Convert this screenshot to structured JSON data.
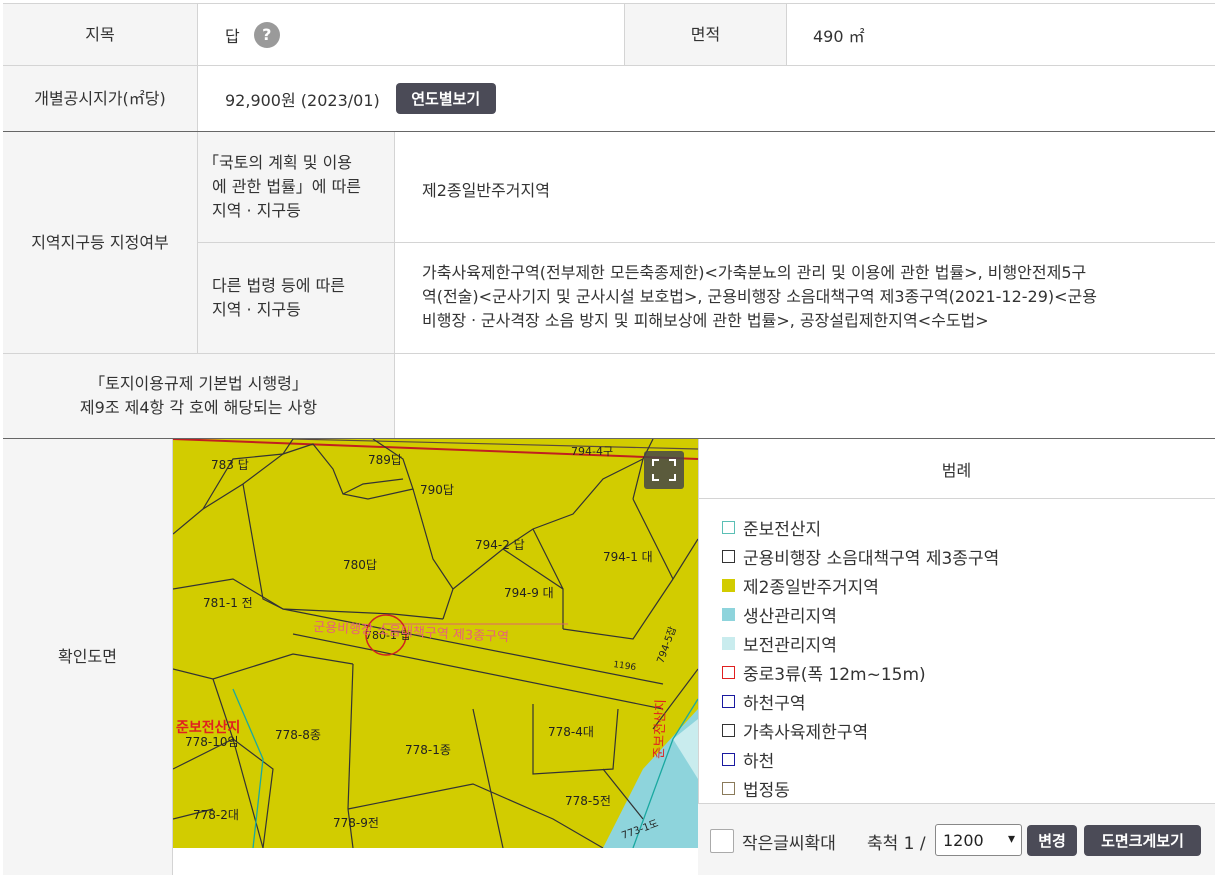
{
  "row1": {
    "jimok_label": "지목",
    "jimok_value": "답",
    "help_icon": "?",
    "area_label": "면적",
    "area_value": "490 ㎡"
  },
  "row2": {
    "price_label": "개별공시지가(㎡당)",
    "price_value": "92,900원 (2023/01)",
    "yearly_button": "연도별보기"
  },
  "zone": {
    "label": "지역지구등 지정여부",
    "sub1_label": [
      "「국토의 계획 및 이용",
      "에 관한 법률」에 따른",
      "지역 · 지구등"
    ],
    "sub1_value": "제2종일반주거지역",
    "sub2_label": [
      "다른 법령 등에 따른",
      "지역 · 지구등"
    ],
    "sub2_value": [
      "가축사육제한구역(전부제한 모든축종제한)<가축분뇨의 관리 및 이용에 관한 법률>, 비행안전제5구",
      "역(전술)<군사기지 및 군사시설 보호법>, 군용비행장 소음대책구역 제3종구역(2021-12-29)<군용",
      "비행장ㆍ군사격장 소음 방지 및 피해보상에 관한 법률>, 공장설립제한지역<수도법>"
    ]
  },
  "enforcement": {
    "label": [
      "「토지이용규제 기본법 시행령」",
      "제9조 제4항 각 호에 해당되는 사항"
    ],
    "value": ""
  },
  "map_section": {
    "label": "확인도면",
    "fullscreen_icon": "fullscreen-icon",
    "parcels": [
      "783 답",
      "789답",
      "790답",
      "780답",
      "794-2 답",
      "794-1 대",
      "794-9 대",
      "781-1 전",
      "780-1 답",
      "778-10임",
      "778-8종",
      "778-1종",
      "778-4대",
      "778-2대",
      "778-9전",
      "778-5전",
      "794-4구",
      "794-5잡",
      "773-1도",
      "1196"
    ],
    "map_labels": {
      "noise_zone": "군용비행장 소음대책구역 제3종구역",
      "forest": "준보전산지",
      "right_edge": "준보전산지"
    }
  },
  "legend": {
    "title": "범례",
    "items": [
      {
        "label": "준보전산지",
        "color": "#5bbfb5",
        "style": "outline"
      },
      {
        "label": "군용비행장 소음대책구역 제3종구역",
        "color": "#333333",
        "style": "outline"
      },
      {
        "label": "제2종일반주거지역",
        "color": "#d2cc00",
        "style": "filled"
      },
      {
        "label": "생산관리지역",
        "color": "#8ed4dc",
        "style": "filled"
      },
      {
        "label": "보전관리지역",
        "color": "#c9ecee",
        "style": "filled"
      },
      {
        "label": "중로3류(폭 12m~15m)",
        "color": "#e02020",
        "style": "outline"
      },
      {
        "label": "하천구역",
        "color": "#1a1aa0",
        "style": "outline"
      },
      {
        "label": "가축사육제한구역",
        "color": "#333333",
        "style": "outline"
      },
      {
        "label": "하천",
        "color": "#1a1aa0",
        "style": "outline"
      },
      {
        "label": "법정동",
        "color": "#8a7a5a",
        "style": "outline"
      }
    ]
  },
  "controls": {
    "small_text_label": "작은글씨확대",
    "scale_label": "축척 1 /",
    "scale_value": "1200",
    "change_button": "변경",
    "enlarge_button": "도면크게보기"
  },
  "colors": {
    "label_bg": "#f5f5f5",
    "button_bg": "#4b4b57",
    "map_yellow": "#d2cc00"
  }
}
